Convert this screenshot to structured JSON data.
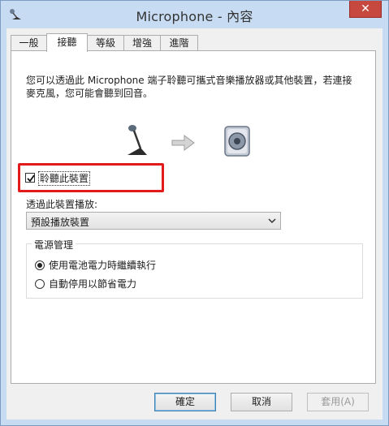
{
  "window": {
    "title": "Microphone - 內容",
    "close_glyph": "✕",
    "app_icon": "microphone-icon"
  },
  "tabs": [
    {
      "label": "一般",
      "active": false
    },
    {
      "label": "接聽",
      "active": true
    },
    {
      "label": "等級",
      "active": false
    },
    {
      "label": "增強",
      "active": false
    },
    {
      "label": "進階",
      "active": false
    }
  ],
  "listen": {
    "description": "您可以透過此 Microphone 端子聆聽可攜式音樂播放器或其他裝置，若連接麥克風，您可能會聽到回音。",
    "illustration_icons": [
      "microphone-icon",
      "arrow-right-icon",
      "speaker-icon"
    ],
    "checkbox_label": "聆聽此裝置",
    "checkbox_checked": true,
    "highlight_color": "#e21a1a",
    "playback_label": "透過此裝置播放:",
    "playback_selected": "預設播放裝置"
  },
  "power": {
    "title": "電源管理",
    "options": [
      {
        "label": "使用電池電力時繼續執行",
        "checked": true
      },
      {
        "label": "自動停用以節省電力",
        "checked": false
      }
    ]
  },
  "buttons": {
    "ok": "確定",
    "cancel": "取消",
    "apply": "套用(A)"
  }
}
